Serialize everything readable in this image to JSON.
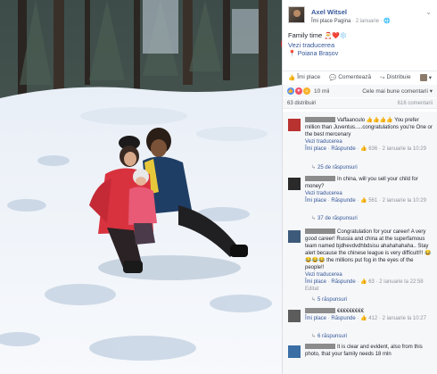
{
  "post": {
    "author": "Axel Witsel",
    "like_page": "Îmi place Pagina",
    "date": "2 ianuarie",
    "globe": "🌐",
    "caption": "Family time",
    "caption_emoji": "🎅❤️❄️",
    "translate": "Vezi traducerea",
    "place": "Poiana Brașov",
    "pin": "📍"
  },
  "actions": {
    "like": "Îmi place",
    "comment": "Comentează",
    "share": "Distribuie"
  },
  "reactions": {
    "count": "10 mii",
    "sort": "Cele mai bune comentarii ▾"
  },
  "stats": {
    "shares": "63 distribuiri",
    "comments_count": "616 comentarii"
  },
  "comments": [
    {
      "text": "Vaffaanculo 👍👍👍👍 You prefer million than Juventus.....congratulations you're One or the best mercenary",
      "translate": "Vezi traducerea",
      "like": "Îmi place",
      "reply": "Răspunde",
      "likes": "636",
      "date": "2 ianuarie la 10:29",
      "replies": "25 de răspunsuri"
    },
    {
      "text": "In china, will you sell your child for money?",
      "translate": "Vezi traducerea",
      "like": "Îmi place",
      "reply": "Răspunde",
      "likes": "561",
      "date": "2 ianuarie la 10:29",
      "replies": "37 de răspunsuri"
    },
    {
      "text": "Congratulation for your career! A very good career! Russia and china at the superfamous team named bjdhevdvdhbdsisu ahahahahaha.. Stay alert because the chinese league is very difficult!!! 😂😂😂😂 the millions put fog in the eyes of the people!!",
      "translate": "Vezi traducerea",
      "like": "Îmi place",
      "reply": "Răspunde",
      "likes": "63",
      "date": "2 ianuarie la 22:58",
      "edited": "Editat",
      "replies": "5 răspunsuri"
    },
    {
      "text": "€€€€€€€€€",
      "like": "Îmi place",
      "reply": "Răspunde",
      "likes": "412",
      "date": "2 ianuarie la 10:27",
      "replies": "6 răspunsuri"
    },
    {
      "text": "It is clear and evident, also from this photo, that your family needs 18 mln"
    }
  ],
  "colors": {
    "link": "#365899",
    "annotation": "#d0262d",
    "background": "#f6f7f9"
  }
}
